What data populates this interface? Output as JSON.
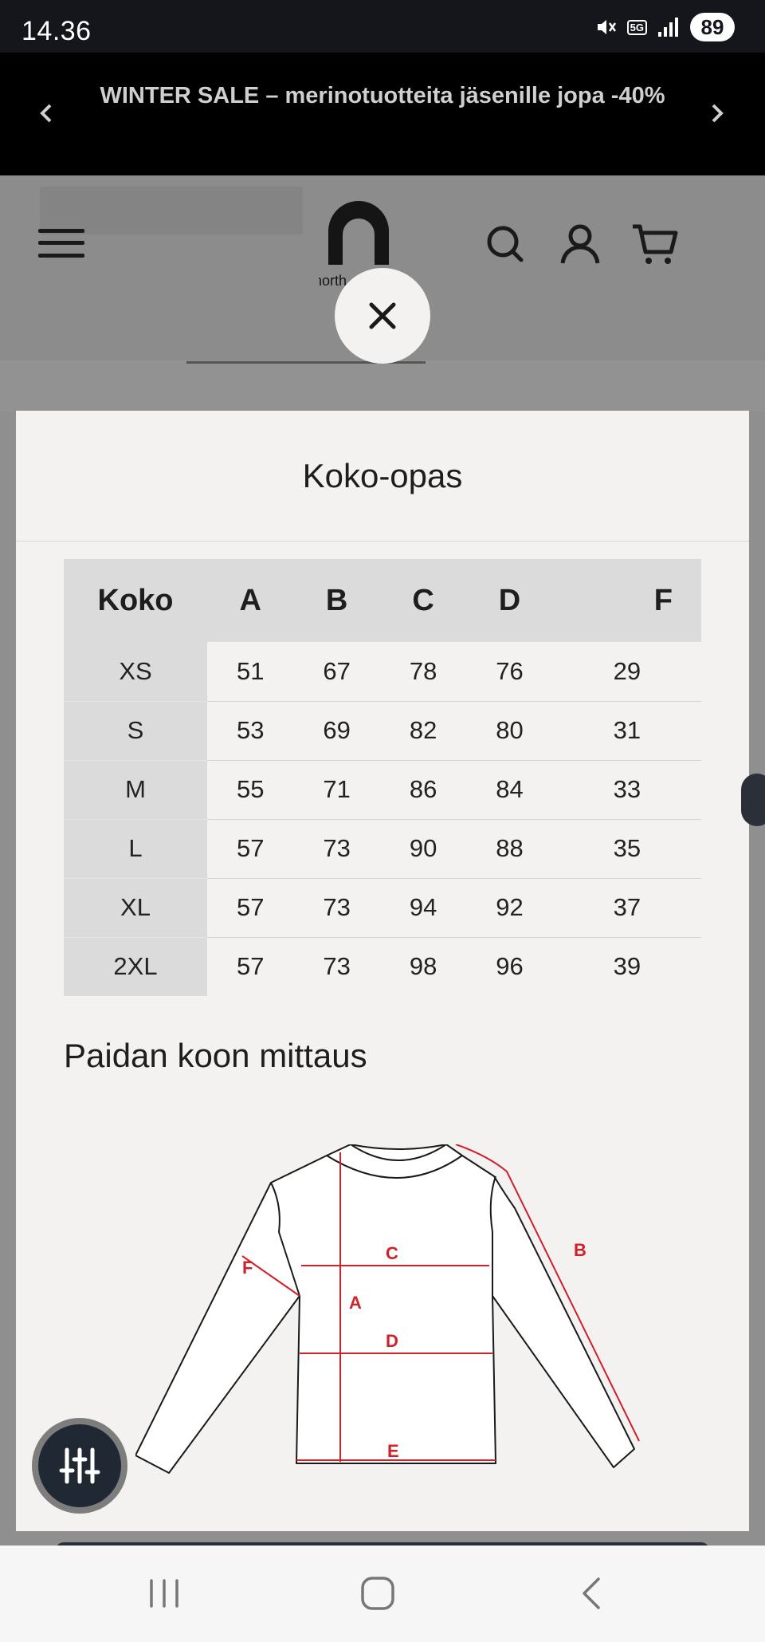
{
  "status_bar": {
    "time": "14.36",
    "network": "5G",
    "battery": "89"
  },
  "promo": {
    "text": "WINTER SALE – merinotuotteita jäsenille jopa -40%"
  },
  "header": {
    "logo_text": "north"
  },
  "modal": {
    "title": "Koko-opas",
    "table": {
      "headers": [
        "Koko",
        "A",
        "B",
        "C",
        "D",
        "F"
      ],
      "rows": [
        [
          "XS",
          "51",
          "67",
          "78",
          "76",
          "29"
        ],
        [
          "S",
          "53",
          "69",
          "82",
          "80",
          "31"
        ],
        [
          "M",
          "55",
          "71",
          "86",
          "84",
          "33"
        ],
        [
          "L",
          "57",
          "73",
          "90",
          "88",
          "35"
        ],
        [
          "XL",
          "57",
          "73",
          "94",
          "92",
          "37"
        ],
        [
          "2XL",
          "57",
          "73",
          "98",
          "96",
          "39"
        ]
      ]
    },
    "measure_title": "Paidan koon mittaus",
    "diagram_labels": {
      "a": "A",
      "b": "B",
      "c": "C",
      "d": "D",
      "e": "E",
      "f": "F"
    },
    "accent_color": "#d0202a"
  },
  "icons": {
    "promo_prev": "chevron-left-icon",
    "promo_next": "chevron-right-icon",
    "menu": "hamburger-icon",
    "search": "search-icon",
    "account": "user-icon",
    "cart": "cart-icon",
    "close": "close-icon",
    "filter": "sliders-icon",
    "nav_recents": "recents-icon",
    "nav_home": "home-icon",
    "nav_back": "back-icon"
  }
}
